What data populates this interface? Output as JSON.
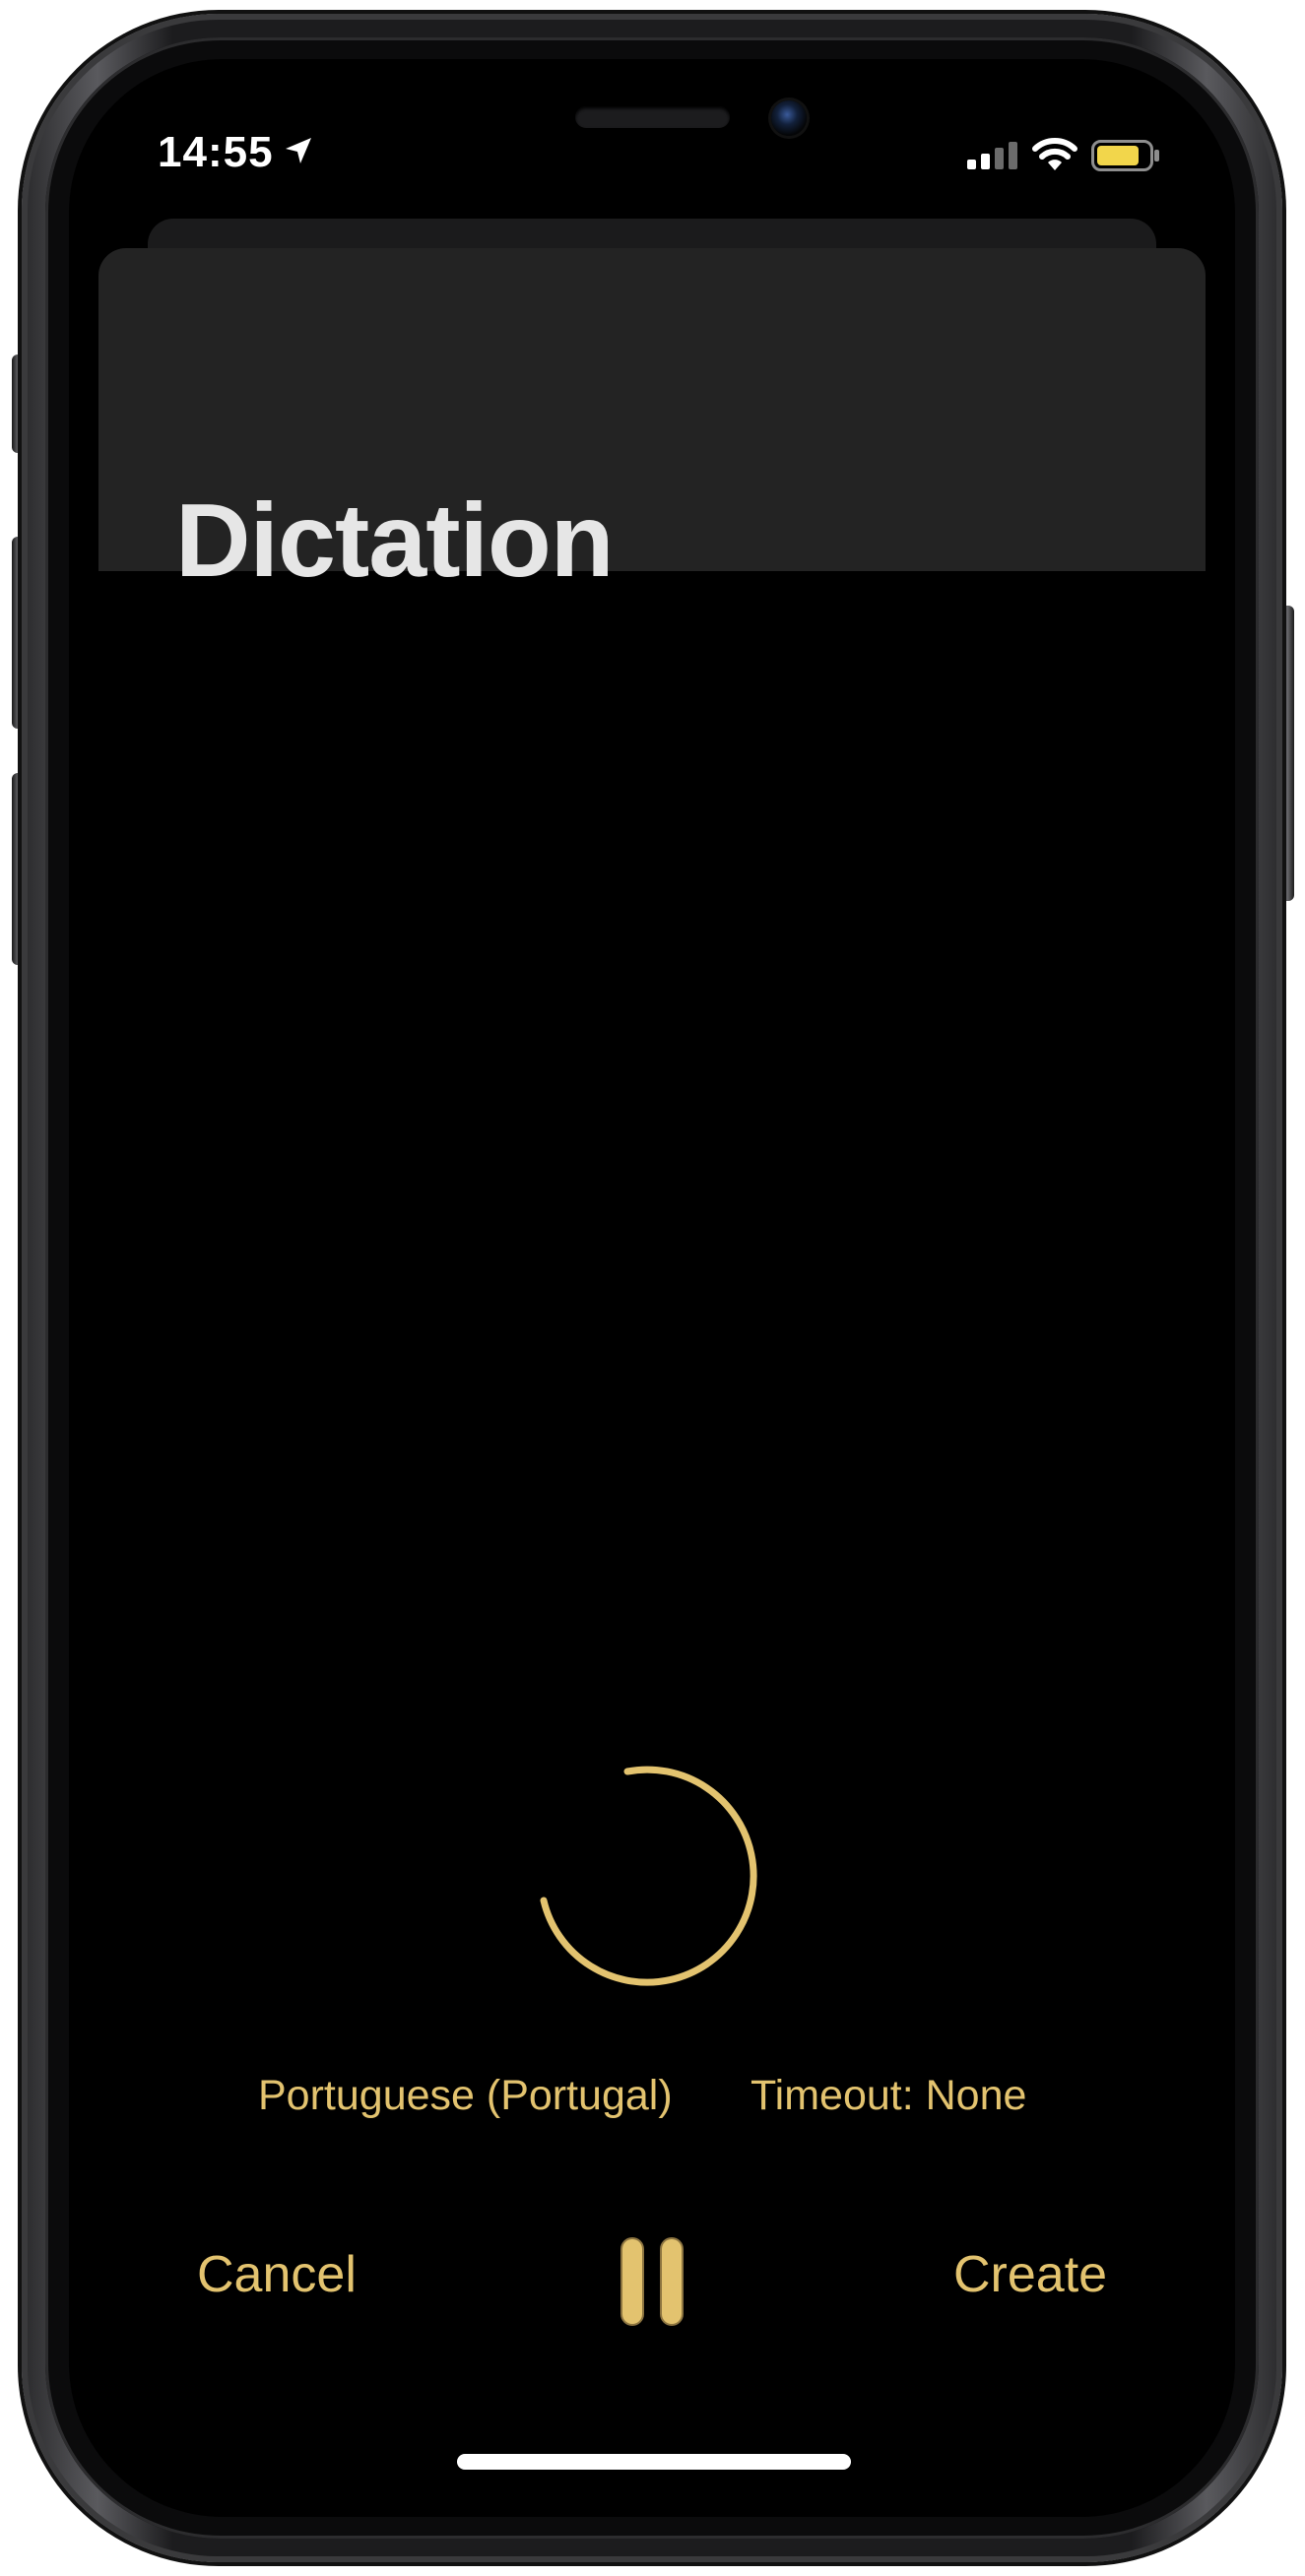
{
  "status_bar": {
    "time": "14:55",
    "icons": [
      "location-arrow-icon",
      "cellular-signal-icon",
      "wifi-icon",
      "battery-icon"
    ],
    "battery_color": "#f2d64b"
  },
  "header": {
    "title": "Dictation"
  },
  "dictation": {
    "state": "listening",
    "language": "Portuguese (Portugal)",
    "timeout": "Timeout: None"
  },
  "actions": {
    "cancel_label": "Cancel",
    "pause_icon": "pause-icon",
    "create_label": "Create"
  },
  "colors": {
    "accent": "#e3c36f",
    "background": "#000000",
    "header_sheet": "#232323",
    "title_text": "#e6e6e6"
  }
}
